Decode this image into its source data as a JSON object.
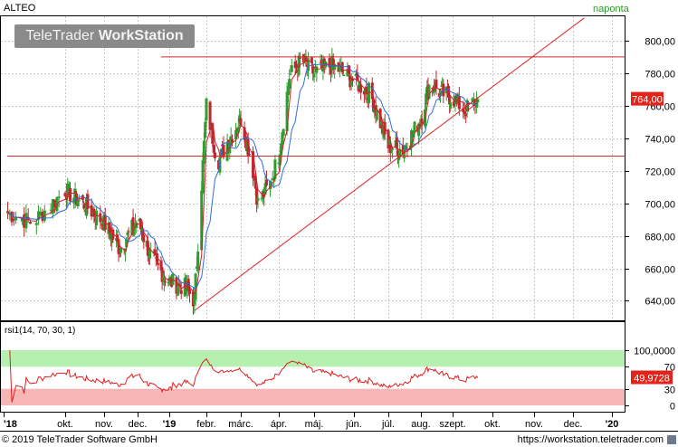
{
  "header": {
    "symbol": "ALTEO",
    "brand_light": "TeleTrader",
    "brand_bold": "WorkStation",
    "period": "naponta"
  },
  "footer": {
    "copyright": "© 2019 TeleTrader Software GmbH",
    "url": "https://workstation.teletrader.com"
  },
  "colors": {
    "up_candle": "#2e9e2e",
    "down_candle": "#c0262f",
    "ma_fast": "#d0202a",
    "ma_slow": "#2a6ee0",
    "level_line": "#d02a2a",
    "trend_line": "#e02020",
    "rsi_line": "#e02020",
    "rsi_upper_band": "#b6f0b0",
    "rsi_lower_band": "#f7b6b6",
    "last_price_tag": "#e2231a",
    "period_label": "#2a9a2a"
  },
  "chart_data": [
    {
      "type": "candlestick",
      "title": "ALTEO",
      "period": "naponta",
      "x_ticks": [
        "'18",
        "okt.",
        "nov.",
        "dec.",
        "'19",
        "febr.",
        "márc.",
        "ápr.",
        "máj.",
        "jún.",
        "júl.",
        "aug.",
        "szept.",
        "okt.",
        "nov.",
        "dec.",
        "'20"
      ],
      "ylim": [
        628,
        815
      ],
      "y_ticks": [
        "640,00",
        "660,00",
        "680,00",
        "700,00",
        "720,00",
        "740,00",
        "760,00",
        "780,00",
        "800,00"
      ],
      "last_price": "764,00",
      "horizontal_levels": [
        790,
        729
      ],
      "trend_line": {
        "from": [
          "2019-01-22",
          634
        ],
        "to": [
          "2019-12-10",
          814
        ]
      },
      "series": [
        {
          "kind": "ohlc",
          "daily_close_path": [
            [
              "2018-09-01",
              695
            ],
            [
              "2018-09-15",
              688
            ],
            [
              "2018-10-01",
              708
            ],
            [
              "2018-10-15",
              700
            ],
            [
              "2018-11-01",
              688
            ],
            [
              "2018-11-15",
              672
            ],
            [
              "2018-12-01",
              690
            ],
            [
              "2018-12-15",
              665
            ],
            [
              "2019-01-01",
              652
            ],
            [
              "2019-01-15",
              648
            ],
            [
              "2019-01-22",
              640
            ],
            [
              "2019-02-01",
              760
            ],
            [
              "2019-02-10",
              725
            ],
            [
              "2019-02-20",
              740
            ],
            [
              "2019-03-01",
              752
            ],
            [
              "2019-03-10",
              725
            ],
            [
              "2019-03-15",
              700
            ],
            [
              "2019-03-25",
              712
            ],
            [
              "2019-04-01",
              730
            ],
            [
              "2019-04-10",
              778
            ],
            [
              "2019-04-20",
              788
            ],
            [
              "2019-05-01",
              780
            ],
            [
              "2019-05-15",
              785
            ],
            [
              "2019-06-01",
              775
            ],
            [
              "2019-06-15",
              768
            ],
            [
              "2019-07-01",
              735
            ],
            [
              "2019-07-15",
              733
            ],
            [
              "2019-08-01",
              752
            ],
            [
              "2019-08-10",
              775
            ],
            [
              "2019-08-20",
              768
            ],
            [
              "2019-09-01",
              765
            ],
            [
              "2019-09-10",
              757
            ],
            [
              "2019-09-20",
              764
            ]
          ]
        }
      ]
    },
    {
      "type": "line",
      "title": "rsi1(14, 70, 30, 1)",
      "ylim": [
        0,
        100
      ],
      "y_ticks": [
        "0",
        "30",
        "70",
        "100,0000"
      ],
      "bands": {
        "overbought": 70,
        "oversold": 30
      },
      "last_value": "49,9728"
    }
  ]
}
